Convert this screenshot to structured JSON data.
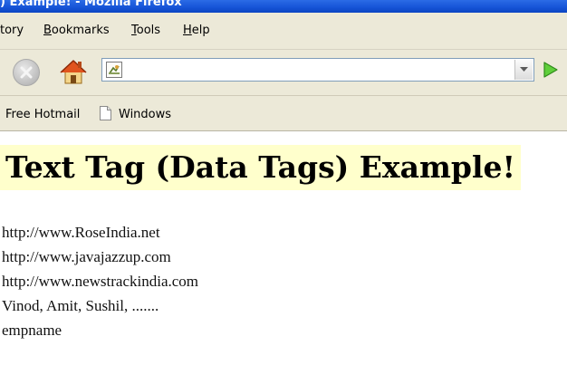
{
  "window": {
    "title": ") Example! - Mozilla Firefox"
  },
  "menu": {
    "items": [
      {
        "label": "tory"
      },
      {
        "underline": "B",
        "rest": "ookmarks"
      },
      {
        "underline": "T",
        "rest": "ools"
      },
      {
        "underline": "H",
        "rest": "elp"
      }
    ]
  },
  "toolbar": {
    "stop_icon": "stop-icon",
    "home_icon": "home-icon",
    "go_icon": "go-arrow-icon",
    "address_value": "",
    "address_placeholder": ""
  },
  "bookmarks": {
    "items": [
      {
        "label": "Free Hotmail"
      },
      {
        "label": "Windows",
        "icon": "page-icon"
      }
    ]
  },
  "page": {
    "heading": "Text Tag (Data Tags) Example!",
    "heading_background": "#ffffcc",
    "lines": [
      "http://www.RoseIndia.net",
      "http://www.javajazzup.com",
      "http://www.newstrackindia.com",
      "Vinod, Amit, Sushil, .......",
      "empname"
    ]
  }
}
